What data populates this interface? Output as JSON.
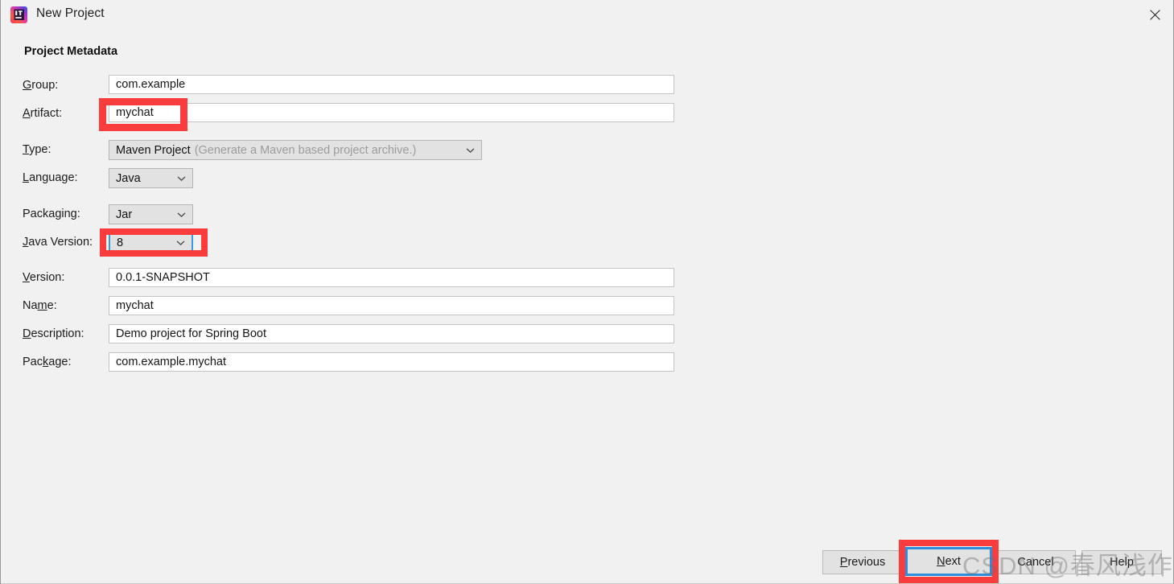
{
  "window": {
    "title": "New Project",
    "icon": "intellij-idea-icon",
    "close_label": "×"
  },
  "section": {
    "title": "Project Metadata"
  },
  "form": {
    "fields": [
      {
        "label": "Group:",
        "mnemonic": "G",
        "value": "com.example",
        "type": "text"
      },
      {
        "label": "Artifact:",
        "mnemonic": "A",
        "value": "mychat",
        "type": "text"
      },
      {
        "label": "Type:",
        "mnemonic": "T",
        "value": "Maven Project",
        "hint": "(Generate a Maven based project archive.)",
        "type": "combo"
      },
      {
        "label": "Language:",
        "mnemonic": "L",
        "value": "Java",
        "type": "combo"
      },
      {
        "label": "Packaging:",
        "mnemonic": "g",
        "value": "Jar",
        "type": "combo"
      },
      {
        "label": "Java Version:",
        "mnemonic": "J",
        "value": "8",
        "type": "combo"
      },
      {
        "label": "Version:",
        "mnemonic": "V",
        "value": "0.0.1-SNAPSHOT",
        "type": "text"
      },
      {
        "label": "Name:",
        "mnemonic": "m",
        "value": "mychat",
        "type": "text"
      },
      {
        "label": "Description:",
        "mnemonic": "D",
        "value": "Demo project for Spring Boot",
        "type": "text"
      },
      {
        "label": "Package:",
        "mnemonic": "k",
        "value": "com.example.mychat",
        "type": "text"
      }
    ]
  },
  "buttons": {
    "previous": "Previous",
    "previous_mnemonic": "P",
    "next": "Next",
    "next_mnemonic": "N",
    "cancel": "Cancel",
    "help": "Help"
  },
  "watermark": {
    "text": "CSDN @春风浅作序"
  },
  "colors": {
    "background": "#f1f1f1",
    "annotation": "#fa3c3c",
    "focus": "#2b8ddb",
    "combo_bg": "#e2e2e2",
    "field_bg": "#ffffff"
  }
}
